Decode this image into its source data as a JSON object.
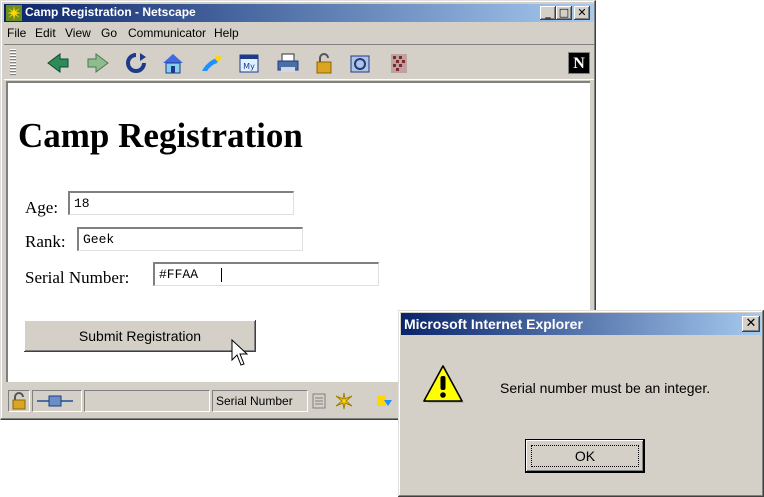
{
  "browser": {
    "title": "Camp Registration - Netscape",
    "menu": [
      "File",
      "Edit",
      "View",
      "Go",
      "Communicator",
      "Help"
    ],
    "toolbar_icons": [
      "back-icon",
      "forward-icon",
      "reload-icon",
      "home-icon",
      "search-icon",
      "my-netscape-icon",
      "print-icon",
      "security-icon",
      "shop-icon",
      "stop-icon"
    ],
    "status_text": "Serial Number"
  },
  "page": {
    "heading": "Camp Registration",
    "fields": [
      {
        "label": "Age:",
        "value": "18"
      },
      {
        "label": "Rank:",
        "value": "Geek"
      },
      {
        "label": "Serial Number:",
        "value": "#FFAA"
      }
    ],
    "submit_label": "Submit Registration"
  },
  "alert": {
    "title": "Microsoft Internet Explorer",
    "message": "Serial number must be an integer.",
    "ok_label": "OK"
  },
  "colors": {
    "titlebar_active": "#0a246a",
    "window_face": "#d4d0c8",
    "warning_yellow": "#ffff00"
  }
}
